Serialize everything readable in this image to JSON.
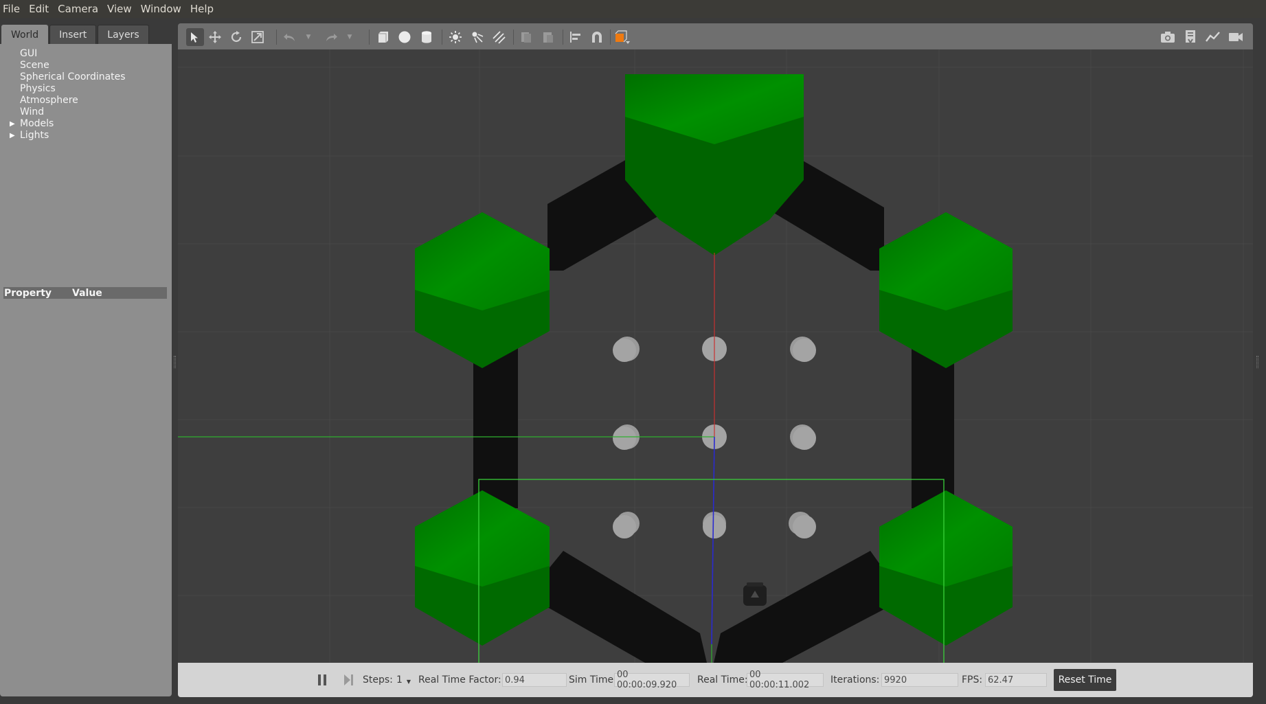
{
  "menu": [
    "File",
    "Edit",
    "Camera",
    "View",
    "Window",
    "Help"
  ],
  "tabs": [
    "World",
    "Insert",
    "Layers"
  ],
  "world_tree": [
    {
      "label": "GUI",
      "expandable": false
    },
    {
      "label": "Scene",
      "expandable": false
    },
    {
      "label": "Spherical Coordinates",
      "expandable": false
    },
    {
      "label": "Physics",
      "expandable": false
    },
    {
      "label": "Atmosphere",
      "expandable": false
    },
    {
      "label": "Wind",
      "expandable": false
    },
    {
      "label": "Models",
      "expandable": true
    },
    {
      "label": "Lights",
      "expandable": true
    }
  ],
  "property_table": {
    "col1": "Property",
    "col2": "Value"
  },
  "toolbar": {
    "tools": [
      "select-icon",
      "translate-icon",
      "rotate-icon",
      "scale-icon",
      "undo-icon",
      "redo-icon",
      "box-icon",
      "sphere-icon",
      "cylinder-icon",
      "point-light-icon",
      "spot-light-icon",
      "directional-light-icon",
      "copy-icon",
      "paste-icon",
      "align-icon",
      "snap-icon",
      "view-angle-icon"
    ],
    "right_tools": [
      "screenshot-icon",
      "log-icon",
      "plot-icon",
      "video-record-icon"
    ]
  },
  "bottom": {
    "steps_label": "Steps:",
    "steps_value": "1",
    "rtf_label": "Real Time Factor:",
    "rtf_value": "0.94",
    "sim_time_label": "Sim Time:",
    "sim_time_value": "00 00:00:09.920",
    "real_time_label": "Real Time:",
    "real_time_value": "00 00:00:11.002",
    "iterations_label": "Iterations:",
    "iterations_value": "9920",
    "fps_label": "FPS:",
    "fps_value": "62.47",
    "reset_label": "Reset Time"
  },
  "colors": {
    "green": "#008a00",
    "wall": "#0f0f0f",
    "ground": "#3e3e3e",
    "cylinder": "#9a9a9a"
  }
}
